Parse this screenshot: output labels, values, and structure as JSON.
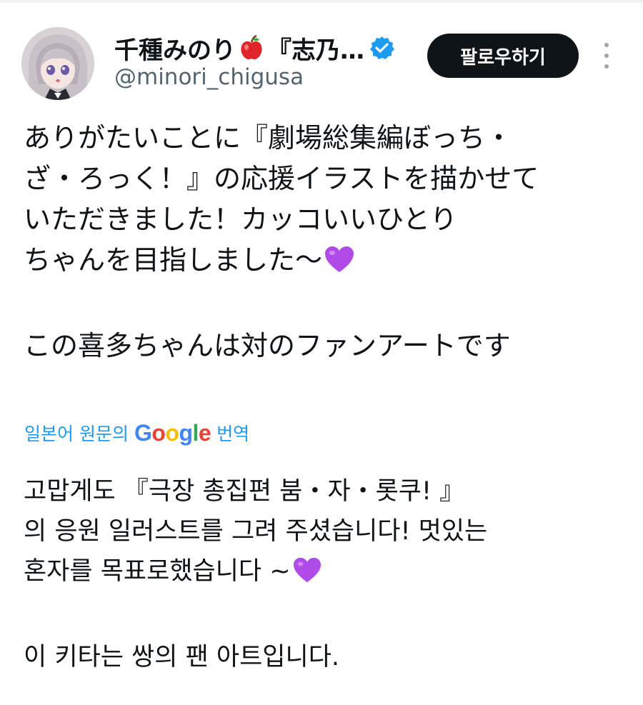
{
  "author": {
    "display_name": "千種みのり",
    "display_name_suffix": "『志乃…",
    "handle": "@minori_chigusa",
    "name_emoji": "apple-icon",
    "verified": true
  },
  "actions": {
    "follow_label": "팔로우하기",
    "more_icon": "more-vertical-icon"
  },
  "tweet": {
    "paragraph_1": "ありがたいことに『劇場総集編ぼっち・\nざ・ろっく！』の応援イラストを描かせて\nいただきました！カッコいいひとり\nちゃんを目指しました〜",
    "paragraph_2": "この喜多ちゃんは対のファンアートです",
    "emoji": "purple-heart-icon"
  },
  "translation": {
    "prefix": "일본어 원문의",
    "provider": "Google",
    "suffix": "번역",
    "paragraph_1": "고맙게도 『극장 총집편 붐・자・롯쿠! 』\n의 응원 일러스트를 그려 주셨습니다! 멋있는\n혼자를 목표로했습니다 ~",
    "paragraph_2": "이 키타는 쌍의 팬 아트입니다."
  },
  "colors": {
    "link_blue": "#1d9bf0",
    "verified_blue": "#1d9bf0",
    "text": "#0f1419",
    "muted": "#536471",
    "heart_purple": "#b04be8"
  }
}
